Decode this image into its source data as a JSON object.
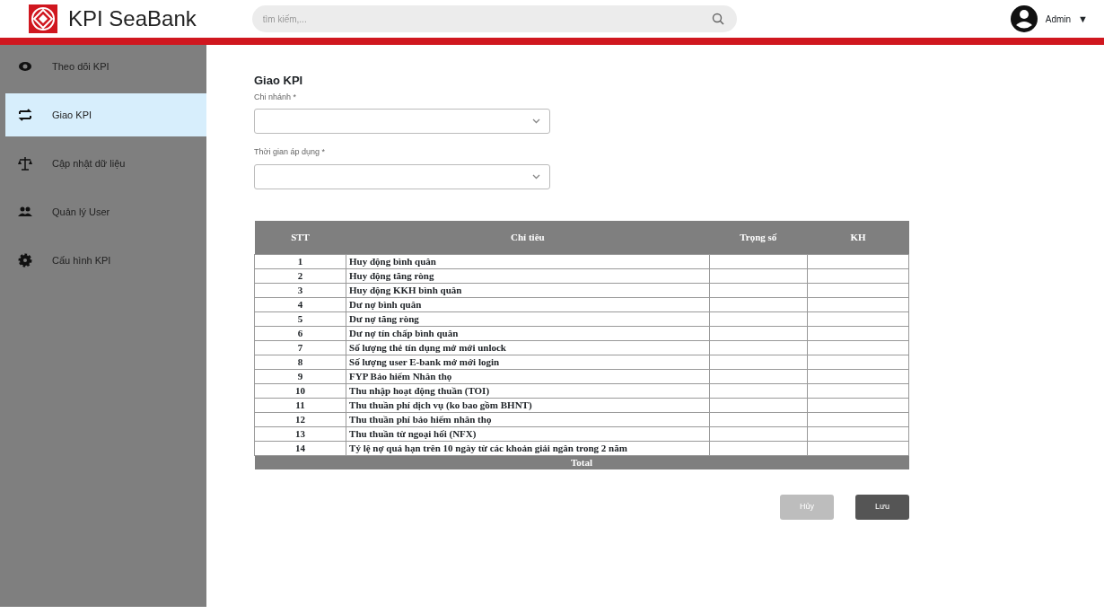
{
  "header": {
    "brand": "KPI SeaBank",
    "search": {
      "placeholder": "tìm kiếm,..."
    },
    "user": "Admin",
    "user_caret": "▼"
  },
  "sidebar": {
    "items": [
      {
        "label": "Theo dõi KPI",
        "kind": "eye",
        "selected": false
      },
      {
        "label": "Giao KPI",
        "kind": "transfer",
        "selected": true
      },
      {
        "label": "Cập nhật dữ liệu",
        "kind": "scale",
        "selected": false
      },
      {
        "label": "Quản lý User",
        "kind": "users",
        "selected": false
      },
      {
        "label": "Cấu hình KPI",
        "kind": "gear",
        "selected": false
      }
    ]
  },
  "form": {
    "title": "Giao KPI",
    "fields": [
      {
        "label": "Chi nhánh",
        "required": "*"
      },
      {
        "label": "Thời gian áp dụng",
        "required": "*"
      }
    ]
  },
  "table": {
    "columns": [
      "STT",
      "Chỉ tiêu",
      "Trọng số",
      "KH"
    ],
    "rows": [
      [
        "1",
        "Huy động bình quân"
      ],
      [
        "2",
        "Huy động tăng ròng"
      ],
      [
        "3",
        "Huy động KKH bình quân"
      ],
      [
        "4",
        "Dư nợ bình quân"
      ],
      [
        "5",
        "Dư nợ tăng ròng"
      ],
      [
        "6",
        "Dư nợ tín chấp bình quân"
      ],
      [
        "7",
        "Số lượng thẻ tín dụng mở mới unlock"
      ],
      [
        "8",
        "Số lượng user E-bank mở mới login"
      ],
      [
        "9",
        "FYP Bảo hiểm Nhân thọ"
      ],
      [
        "10",
        "Thu nhập hoạt động thuần (TOI)"
      ],
      [
        "11",
        "Thu thuần phí dịch vụ (ko bao gồm BHNT)"
      ],
      [
        "12",
        "Thu thuần phí bảo hiểm nhân thọ"
      ],
      [
        "13",
        "Thu thuần từ ngoại hối (NFX)"
      ],
      [
        "14",
        "Tỷ lệ nợ quá hạn trên 10 ngày từ các khoản giải ngân trong 2 năm"
      ]
    ],
    "total": "Total"
  },
  "buttons": [
    {
      "label": "Hủy",
      "kind": "secondary"
    },
    {
      "label": "Lưu",
      "kind": "primary"
    }
  ]
}
